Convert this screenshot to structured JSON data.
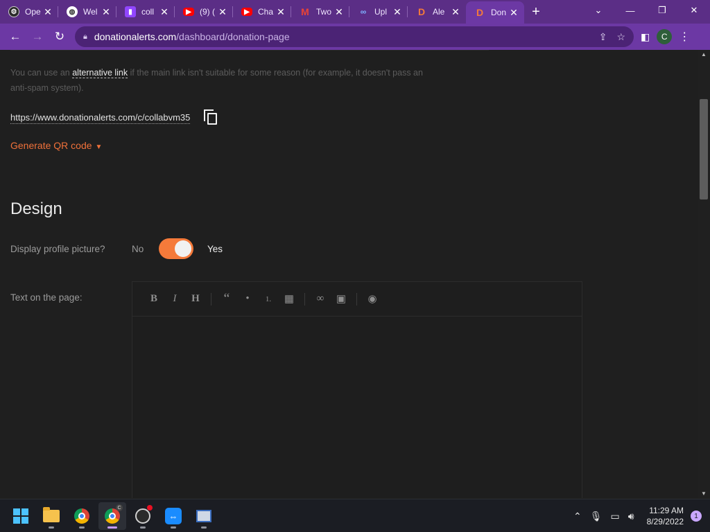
{
  "browser": {
    "tabs": [
      {
        "title": "Ope",
        "favicon": "openai-icon",
        "color": "#2b2b2b"
      },
      {
        "title": "Wel",
        "favicon": "globe-icon",
        "color": "#3b3b3b"
      },
      {
        "title": "coll",
        "favicon": "twitch-icon",
        "color": "#9146ff"
      },
      {
        "title": "(9) (",
        "favicon": "youtube-icon",
        "color": "#ff0000"
      },
      {
        "title": "Cha",
        "favicon": "youtube-icon",
        "color": "#ff0000"
      },
      {
        "title": "Two",
        "favicon": "gmail-icon",
        "color": "#ea4335"
      },
      {
        "title": "Upl",
        "favicon": "upload-icon",
        "color": "#2f6fd6"
      },
      {
        "title": "Ale",
        "favicon": "donationalerts-icon",
        "color": "#f57a3a"
      },
      {
        "title": "Don",
        "favicon": "donationalerts-icon",
        "color": "#f57a3a"
      }
    ],
    "active_tab": 8,
    "new_tab_label": "+",
    "url_host": "donationalerts.com",
    "url_path": "/dashboard/donation-page",
    "profile_initial": "C"
  },
  "page": {
    "note_prefix": "You can use an",
    "note_link": "alternative link",
    "note_suffix": "if the main link isn't suitable for some reason (for example, it doesn't pass an anti-spam system).",
    "alt_url": "https://www.donationalerts.com/c/collabvm35",
    "qr_label": "Generate QR code",
    "design_heading": "Design",
    "profile_label": "Display profile picture?",
    "toggle_off_label": "No",
    "toggle_on_label": "Yes",
    "toggle_on": true,
    "text_label": "Text on the page:",
    "editor_buttons": [
      "B",
      "I",
      "H",
      "“",
      "•",
      "1.",
      "▦",
      "∞",
      "▣",
      "◉"
    ]
  },
  "taskbar": {
    "time": "11:29 AM",
    "date": "8/29/2022",
    "notifications": "1",
    "chrome_profile_badge": "C"
  },
  "colors": {
    "accent": "#f57a3a",
    "browser_frame": "#6c38a4",
    "page_bg": "#1f1f1f"
  }
}
